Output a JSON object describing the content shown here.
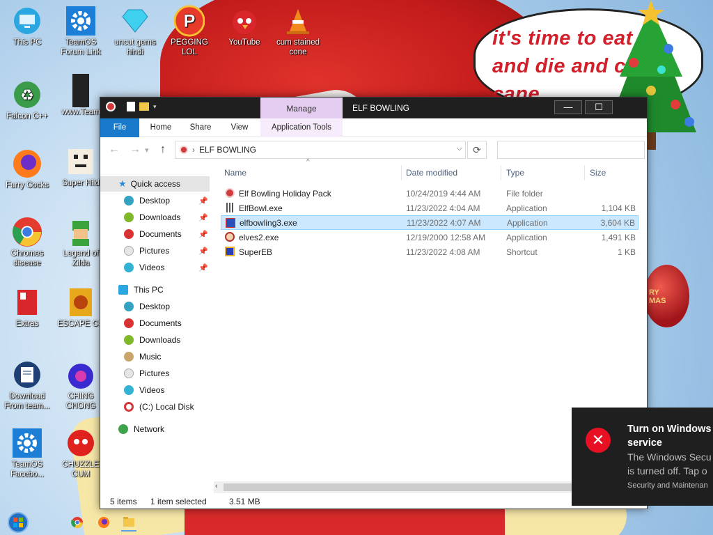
{
  "wallpaper": {
    "speech_bubble_text": "it's time to eat it and die and candy cane"
  },
  "desktop_icons": [
    {
      "label": "This PC",
      "icon": "monitor-icon"
    },
    {
      "label": "TeamOS Forum Link",
      "icon": "gear-icon"
    },
    {
      "label": "uncut gems hindi",
      "icon": "diamond-icon"
    },
    {
      "label": "PEGGING LOL",
      "icon": "p-logo-icon"
    },
    {
      "label": "YouTube",
      "icon": "angry-bird-icon"
    },
    {
      "label": "cum stained cone",
      "icon": "traffic-cone-icon"
    },
    {
      "label": "Falcon C++",
      "icon": "recycle-icon"
    },
    {
      "label": "www.Team",
      "icon": "book-icon"
    },
    {
      "label": "Furry Cocks",
      "icon": "firefox-icon"
    },
    {
      "label": "Super Hild",
      "icon": "pixel-icon"
    },
    {
      "label": "Chromes disease",
      "icon": "chrome-icon"
    },
    {
      "label": "Legend of Zilda",
      "icon": "link-icon"
    },
    {
      "label": "Extras",
      "icon": "gift-icon"
    },
    {
      "label": "ESCAPE CC",
      "icon": "escape-icon"
    },
    {
      "label": "Download From team...",
      "icon": "download-doc-icon"
    },
    {
      "label": "CHING CHONG",
      "icon": "ornament-icon"
    },
    {
      "label": "TeamOS Facebo...",
      "icon": "gear-icon"
    },
    {
      "label": "CHUZZLE CUM",
      "icon": "chuzzle-icon"
    }
  ],
  "explorer": {
    "title": "ELF BOWLING",
    "context_tab": "Manage",
    "ribbon_tabs": [
      "File",
      "Home",
      "Share",
      "View",
      "Application Tools"
    ],
    "address_path": "ELF BOWLING",
    "window_buttons": {
      "minimize": "—",
      "maximize": "☐"
    },
    "nav": {
      "quick_access": "Quick access",
      "quick_items": [
        "Desktop",
        "Downloads",
        "Documents",
        "Pictures",
        "Videos"
      ],
      "this_pc": "This PC",
      "pc_items": [
        "Desktop",
        "Documents",
        "Downloads",
        "Music",
        "Pictures",
        "Videos",
        "(C:) Local Disk"
      ],
      "network": "Network"
    },
    "columns": {
      "name": "Name",
      "date": "Date modified",
      "type": "Type",
      "size": "Size"
    },
    "files": [
      {
        "name": "Elf Bowling Holiday Pack",
        "date": "10/24/2019 4:44 AM",
        "type": "File folder",
        "size": "",
        "icon": "folder-ornament-icon",
        "color": "#d23b3b"
      },
      {
        "name": "ElfBowl.exe",
        "date": "11/23/2022 4:04 AM",
        "type": "Application",
        "size": "1,104 KB",
        "icon": "bowling-pins-icon",
        "color": "#444444"
      },
      {
        "name": "elfbowling3.exe",
        "date": "11/23/2022 4:07 AM",
        "type": "Application",
        "size": "3,604 KB",
        "icon": "elf-app-icon",
        "color": "#2b4fb8"
      },
      {
        "name": "elves2.exe",
        "date": "12/19/2000 12:58 AM",
        "type": "Application",
        "size": "1,491 KB",
        "icon": "elf-face-icon",
        "color": "#b23030"
      },
      {
        "name": "SuperEB",
        "date": "11/23/2022 4:08 AM",
        "type": "Shortcut",
        "size": "1 KB",
        "icon": "superman-icon",
        "color": "#2b3fb8"
      }
    ],
    "selected_index": 2,
    "status": {
      "items": "5 items",
      "selected": "1 item selected",
      "size": "3.51 MB"
    }
  },
  "toast": {
    "title": "Turn on Windows service",
    "body": "The Windows Secu is turned off. Tap o",
    "source": "Security and Maintenan"
  },
  "colors": {
    "accent": "#1979ca",
    "manage_tab": "#e5ccf1",
    "selection": "#cce8ff",
    "toast_error": "#e81123"
  }
}
